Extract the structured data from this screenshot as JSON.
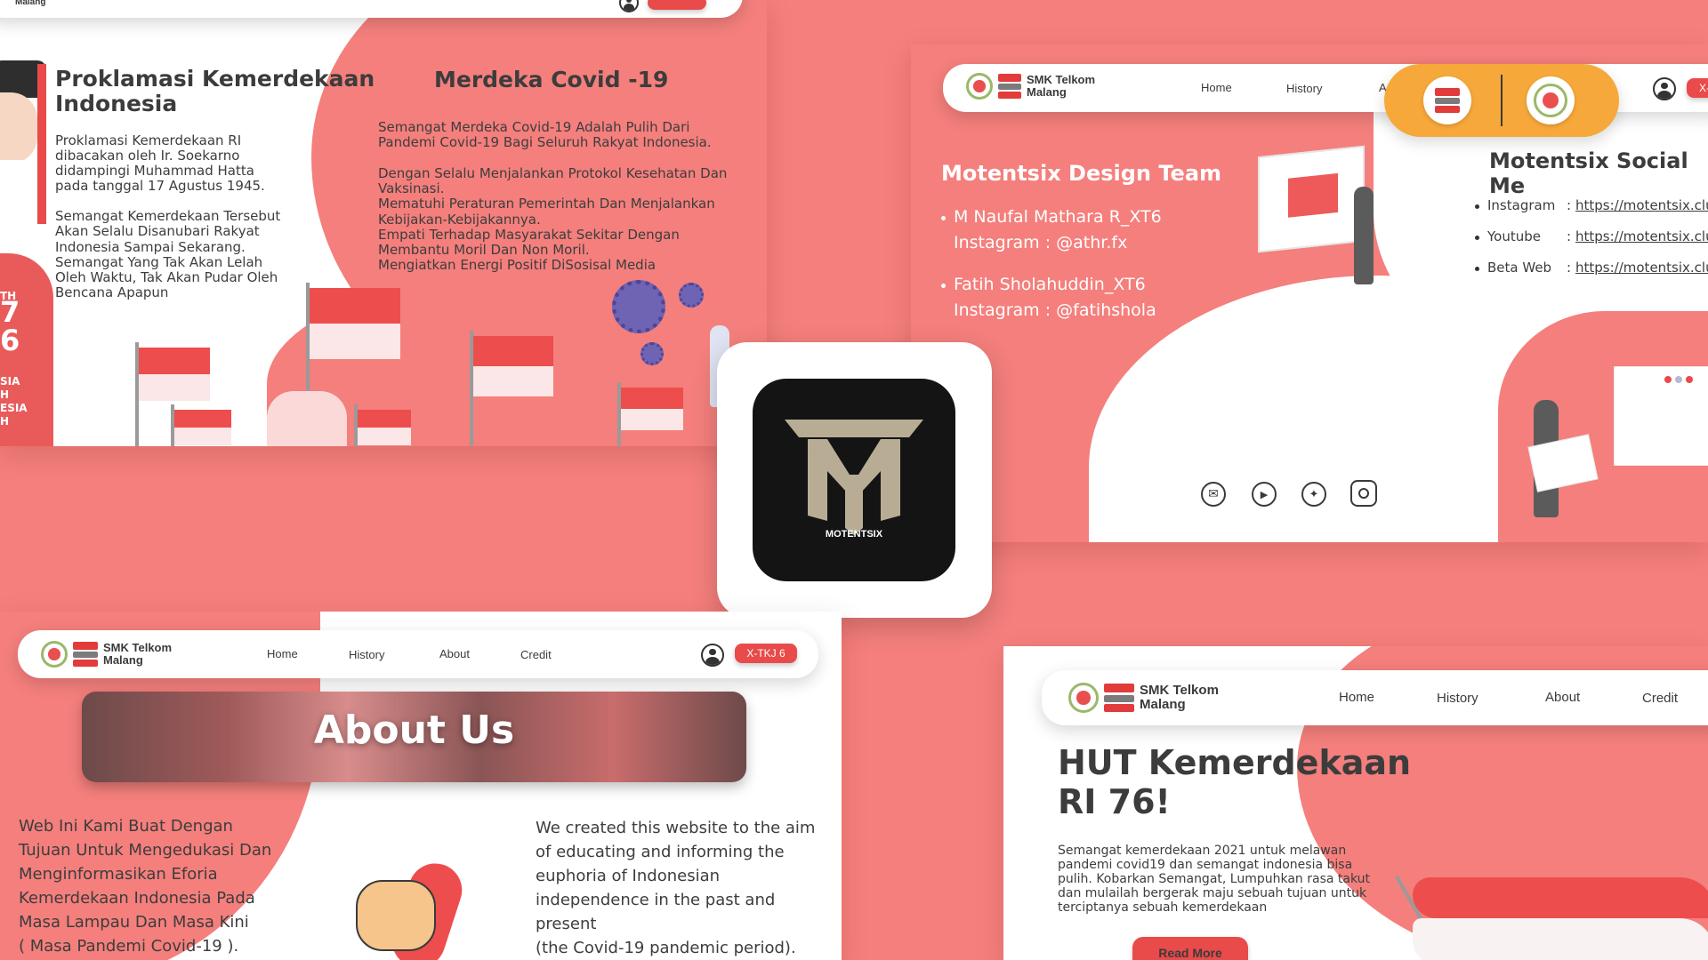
{
  "brand": {
    "line1": "SMK Telkom",
    "line2": "Malang",
    "partial": "Malang"
  },
  "nav": {
    "home": "Home",
    "history": "History",
    "about": "About",
    "credit": "Credit",
    "about_partial": "A",
    "class_tag": "X-TKJ 6",
    "class_tag_partial": "X-"
  },
  "history_panel": {
    "title": "Proklamasi Kemerdekaan Indonesia",
    "body1": "Proklamasi Kemerdekaan RI\ndibacakan oleh Ir. Soekarno\ndidampingi Muhammad Hatta\npada tanggal 17 Agustus 1945.",
    "body2": "Semangat Kemerdekaan Tersebut\nAkan Selalu Disanubari Rakyat\nIndonesia Sampai Sekarang.\nSemangat Yang Tak Akan Lelah\nOleh Waktu, Tak Akan Pudar Oleh\nBencana Apapun",
    "covid_title": "Merdeka Covid -19",
    "covid_body1": "Semangat Merdeka Covid-19 Adalah Pulih Dari\nPandemi Covid-19 Bagi Seluruh Rakyat Indonesia.",
    "covid_body2": "Dengan Selalu Menjalankan Protokol Kesehatan Dan\nVaksinasi.\nMematuhi Peraturan Pemerintah Dan Menjalankan\nKebijakan-Kebijakannya.\nEmpati Terhadap Masyarakat Sekitar Dengan\nMembantu Moril Dan Non Moril.\nMengiatkan Energi Positif DiSosisal Media",
    "badge_lines": [
      "TH",
      "7",
      "6",
      "SIA",
      "H",
      "ESIA",
      "H"
    ]
  },
  "credit_panel": {
    "team_title": "Motentsix Design Team",
    "member1_name": "M Naufal Mathara R_XT6",
    "member1_ig": "Instagram : @athr.fx",
    "member2_name": "Fatih Sholahuddin_XT6",
    "member2_ig": "Instagram : @fatihshola",
    "social_title": "Motentsix Social Me",
    "social": [
      {
        "label": "Instagram",
        "link": "https://motentsix.clu"
      },
      {
        "label": "Youtube",
        "link": "https://motentsix.clu"
      },
      {
        "label": "Beta Web",
        "link": "https://motentsix.clu"
      }
    ],
    "icons": [
      "mail-icon",
      "youtube-icon",
      "twitter-icon",
      "instagram-icon"
    ]
  },
  "app_icon": {
    "label": "MOTENTSIX"
  },
  "about_panel": {
    "banner": "About Us",
    "text_id": "Web Ini Kami Buat Dengan\nTujuan Untuk Mengedukasi Dan\nMenginformasikan Eforia\nKemerdekaan Indonesia Pada\nMasa Lampau Dan Masa Kini\n( Masa Pandemi Covid-19 ).",
    "text_en": "We created this website to the aim\nof educating and informing the\neuphoria of Indonesian\nindependence in the past and\npresent\n(the Covid-19 pandemic period)."
  },
  "home_panel": {
    "title": "HUT Kemerdekaan\nRI 76!",
    "body": "Semangat kemerdekaan 2021 untuk melawan\npandemi covid19 dan semangat indonesia bisa\npulih. Kobarkan Semangat, Lumpuhkan rasa takut\ndan mulailah bergerak maju sebuah tujuan untuk\nterciptanya sebuah kemerdekaan",
    "cta": "Read More"
  },
  "colors": {
    "background": "#f47f7c",
    "accent": "#e94a4a",
    "badge": "#f6a83a",
    "app_icon_bg": "#141414",
    "logo_metal": "#b8ad94"
  }
}
